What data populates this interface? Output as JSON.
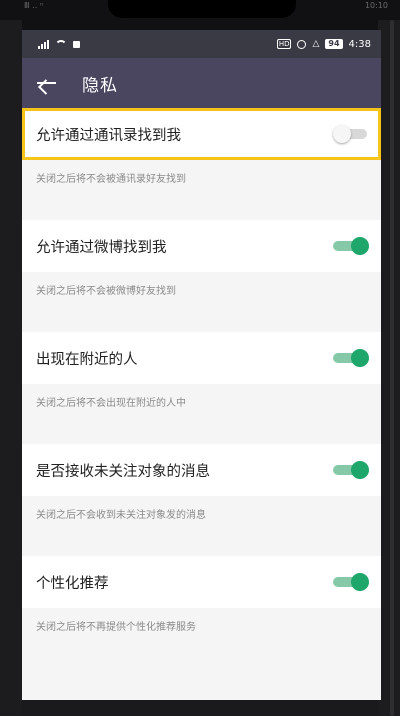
{
  "outer_status": {
    "left": "Ⅲ ‥ ⁿ",
    "right": "10:10"
  },
  "status_bar": {
    "battery": "94",
    "time": "4:38",
    "hd": "HD"
  },
  "app_bar": {
    "title": "隐私"
  },
  "settings": [
    {
      "label": "允许通过通讯录找到我",
      "desc": "关闭之后将不会被通讯录好友找到",
      "enabled": false
    },
    {
      "label": "允许通过微博找到我",
      "desc": "关闭之后将不会被微博好友找到",
      "enabled": true
    },
    {
      "label": "出现在附近的人",
      "desc": "关闭之后将不会出现在附近的人中",
      "enabled": true
    },
    {
      "label": "是否接收未关注对象的消息",
      "desc": "关闭之后不会收到未关注对象发的消息",
      "enabled": true
    },
    {
      "label": "个性化推荐",
      "desc": "关闭之后将不再提供个性化推荐服务",
      "enabled": true
    }
  ],
  "colors": {
    "app_bar": "#4a4660",
    "status_bar": "#3a3a45",
    "toggle_on": "#1fa66a",
    "highlight": "#f6c318"
  }
}
